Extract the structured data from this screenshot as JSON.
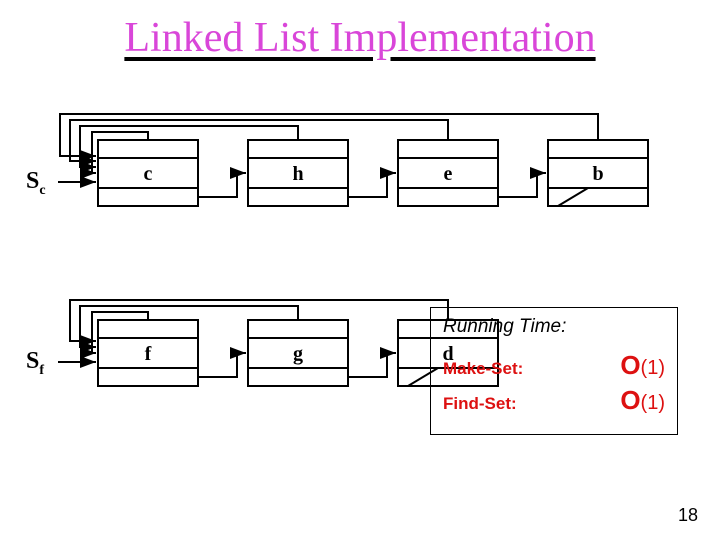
{
  "title": "Linked List Implementation",
  "page_number": "18",
  "sets": {
    "Sc": {
      "label": "S",
      "sub": "c",
      "nodes": [
        "c",
        "h",
        "e",
        "b"
      ]
    },
    "Sf": {
      "label": "S",
      "sub": "f",
      "nodes": [
        "f",
        "g",
        "d"
      ]
    }
  },
  "running_time": {
    "header": "Running Time:",
    "rows": [
      {
        "label": "Make-Set:",
        "value": "O(1)"
      },
      {
        "label": "Find-Set:",
        "value": "O(1)"
      }
    ]
  }
}
